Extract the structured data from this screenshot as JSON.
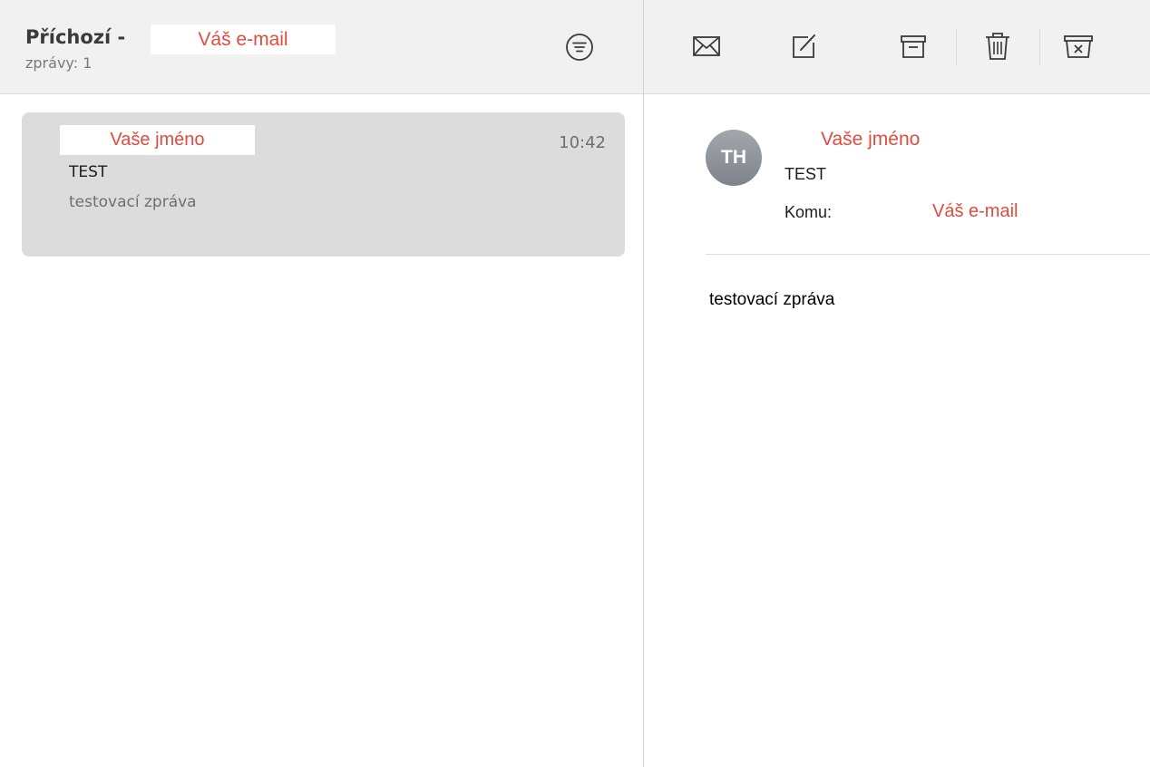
{
  "mailbox": {
    "title": "Příchozí -",
    "email_placeholder": "Váš e-mail",
    "count_text": "zprávy: 1"
  },
  "message_list": [
    {
      "sender": "Vaše jméno",
      "time": "10:42",
      "subject": "TEST",
      "preview": "testovací zpráva"
    }
  ],
  "toolbar": {
    "icons": [
      "envelope-icon",
      "compose-icon",
      "archive-icon",
      "trash-icon",
      "junk-icon"
    ]
  },
  "detail": {
    "avatar_initials": "TH",
    "sender": "Vaše jméno",
    "subject": "TEST",
    "to_label": "Komu:",
    "to_value": "Váš e-mail",
    "body": "testovací zpráva"
  },
  "colors": {
    "redaction_text": "#e34a3c",
    "header_bg": "#f1f1f1",
    "selected_row_bg": "#dcdcdc"
  }
}
